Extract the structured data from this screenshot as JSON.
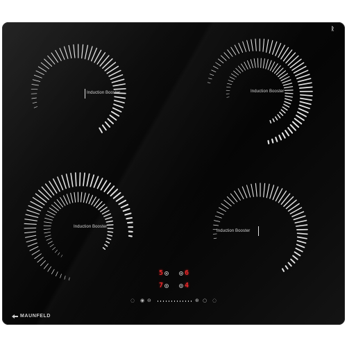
{
  "brand": {
    "name": "MAUNFELD",
    "logo_icon": "maunfeld-logo-icon"
  },
  "zones": [
    {
      "id": "top-left",
      "label": "Induction Booster"
    },
    {
      "id": "top-right",
      "label": "Induction Booster"
    },
    {
      "id": "bottom-left",
      "label": "Induction Booster"
    },
    {
      "id": "bottom-right",
      "label": "Induction Booster"
    }
  ],
  "displays": {
    "top_left": "5",
    "top_right": "6",
    "bottom_left": "7",
    "bottom_right": "4"
  },
  "controls": {
    "power_icon": "power-icon",
    "lock_icon": "lock-icon",
    "minus_icon": "minus-icon",
    "plus_icon": "plus-icon",
    "timer_icon": "timer-icon"
  },
  "colors": {
    "glass": "#080808",
    "markings": "#e6e6e6",
    "display": "#e8282a"
  }
}
